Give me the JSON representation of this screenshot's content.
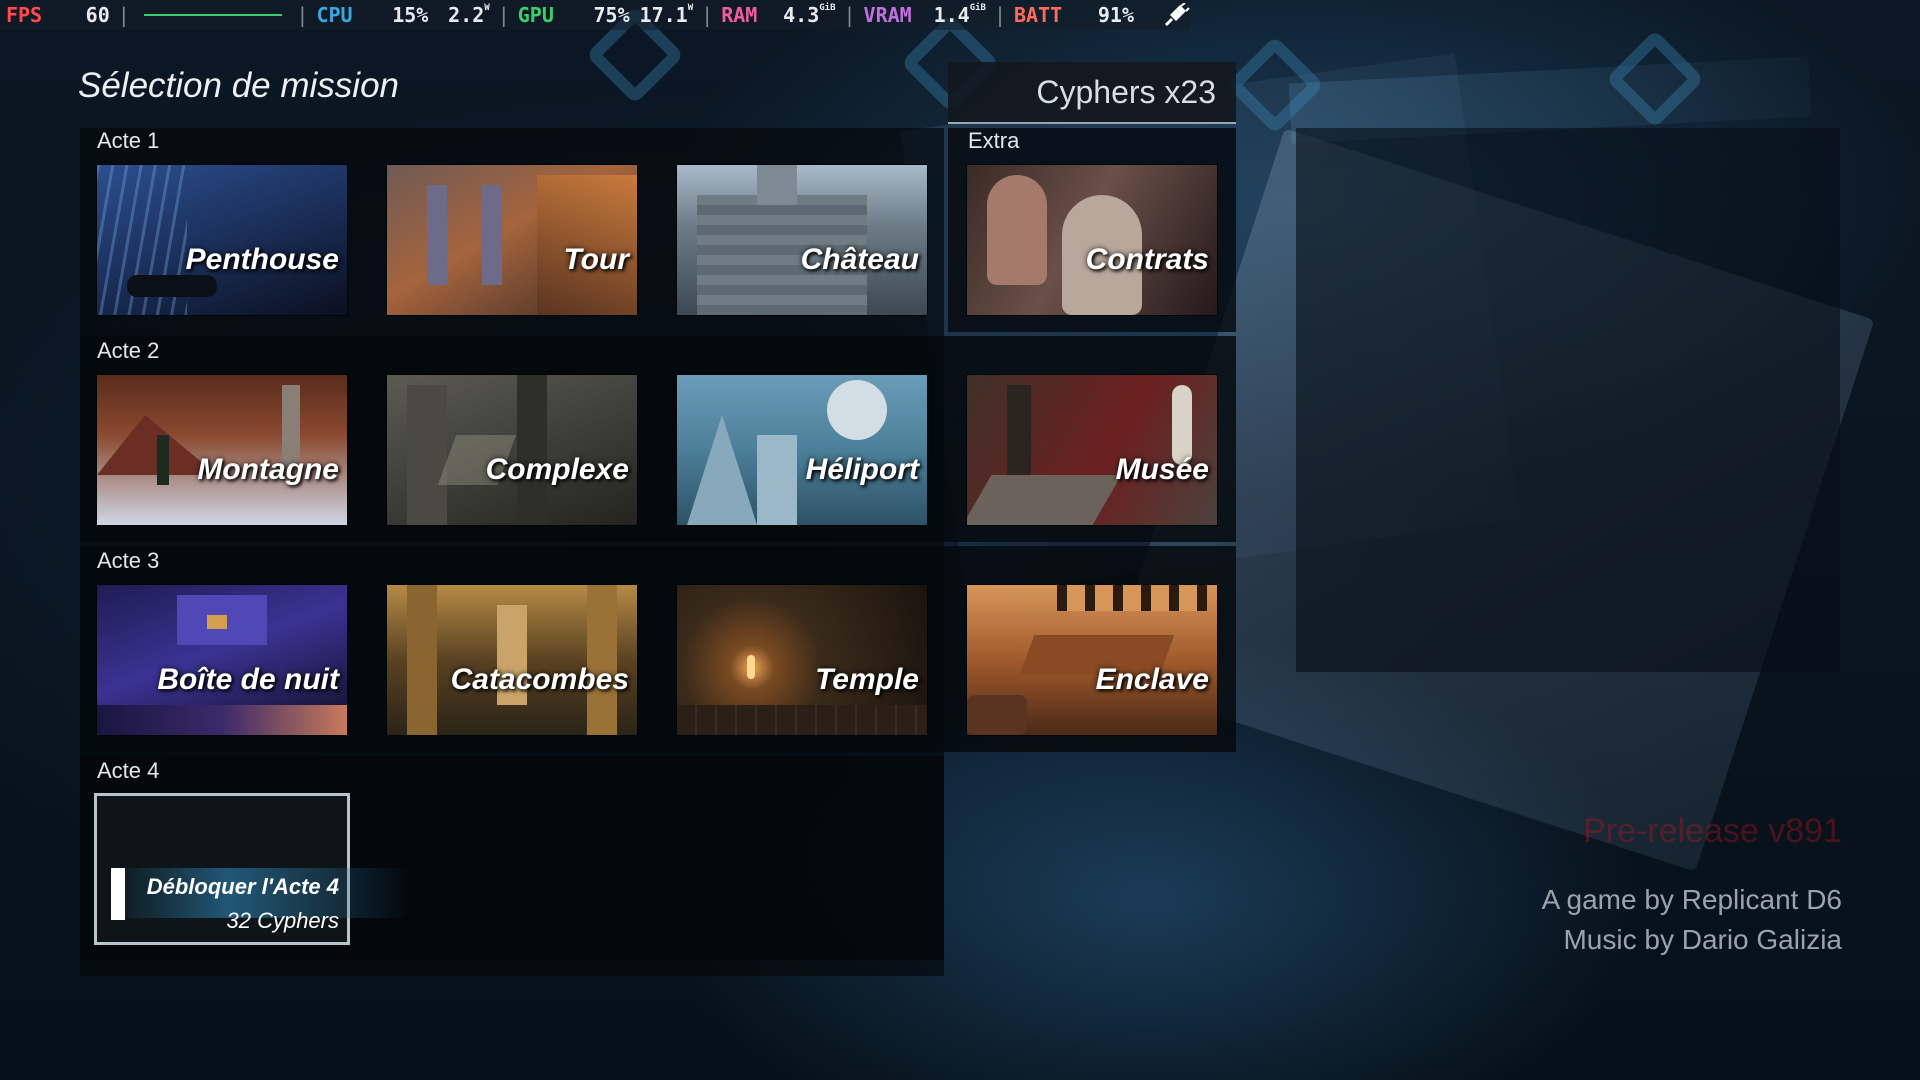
{
  "perf": {
    "fps_label": "FPS",
    "fps_value": "60",
    "cpu_label": "CPU",
    "cpu_pct": "15%",
    "cpu_watts": "2.2",
    "gpu_label": "GPU",
    "gpu_pct": "75%",
    "gpu_watts": "17.1",
    "watt_unit": "W",
    "ram_label": "RAM",
    "ram_value": "4.3",
    "vram_label": "VRAM",
    "vram_value": "1.4",
    "gib_unit": "GiB",
    "batt_label": "BATT",
    "batt_value": "91%",
    "colors": {
      "fps": "#ff4b4b",
      "cpu": "#38a7e6",
      "gpu": "#3ad06a",
      "ram": "#f05d9b",
      "vram": "#c26fe0",
      "batt": "#ff6a5a"
    }
  },
  "header": {
    "title": "Sélection de mission",
    "cyphers": "Cyphers x23"
  },
  "acts": [
    {
      "label": "Acte 1",
      "missions": [
        "Penthouse",
        "Tour",
        "Château"
      ]
    },
    {
      "label": "Acte 2",
      "missions": [
        "Montagne",
        "Complexe",
        "Héliport",
        "Musée"
      ]
    },
    {
      "label": "Acte 3",
      "missions": [
        "Boîte de nuit",
        "Catacombes",
        "Temple",
        "Enclave"
      ]
    },
    {
      "label": "Acte 4"
    }
  ],
  "extra": {
    "label": "Extra",
    "missions": [
      "Contrats"
    ]
  },
  "unlock": {
    "title": "Débloquer l'Acte 4",
    "cost": "32 Cyphers"
  },
  "credits": {
    "version": "Pre-release v891",
    "game_by": "A game by Replicant D6",
    "music_by": "Music by Dario Galizia"
  },
  "icons": {
    "plug": "plug-icon"
  }
}
